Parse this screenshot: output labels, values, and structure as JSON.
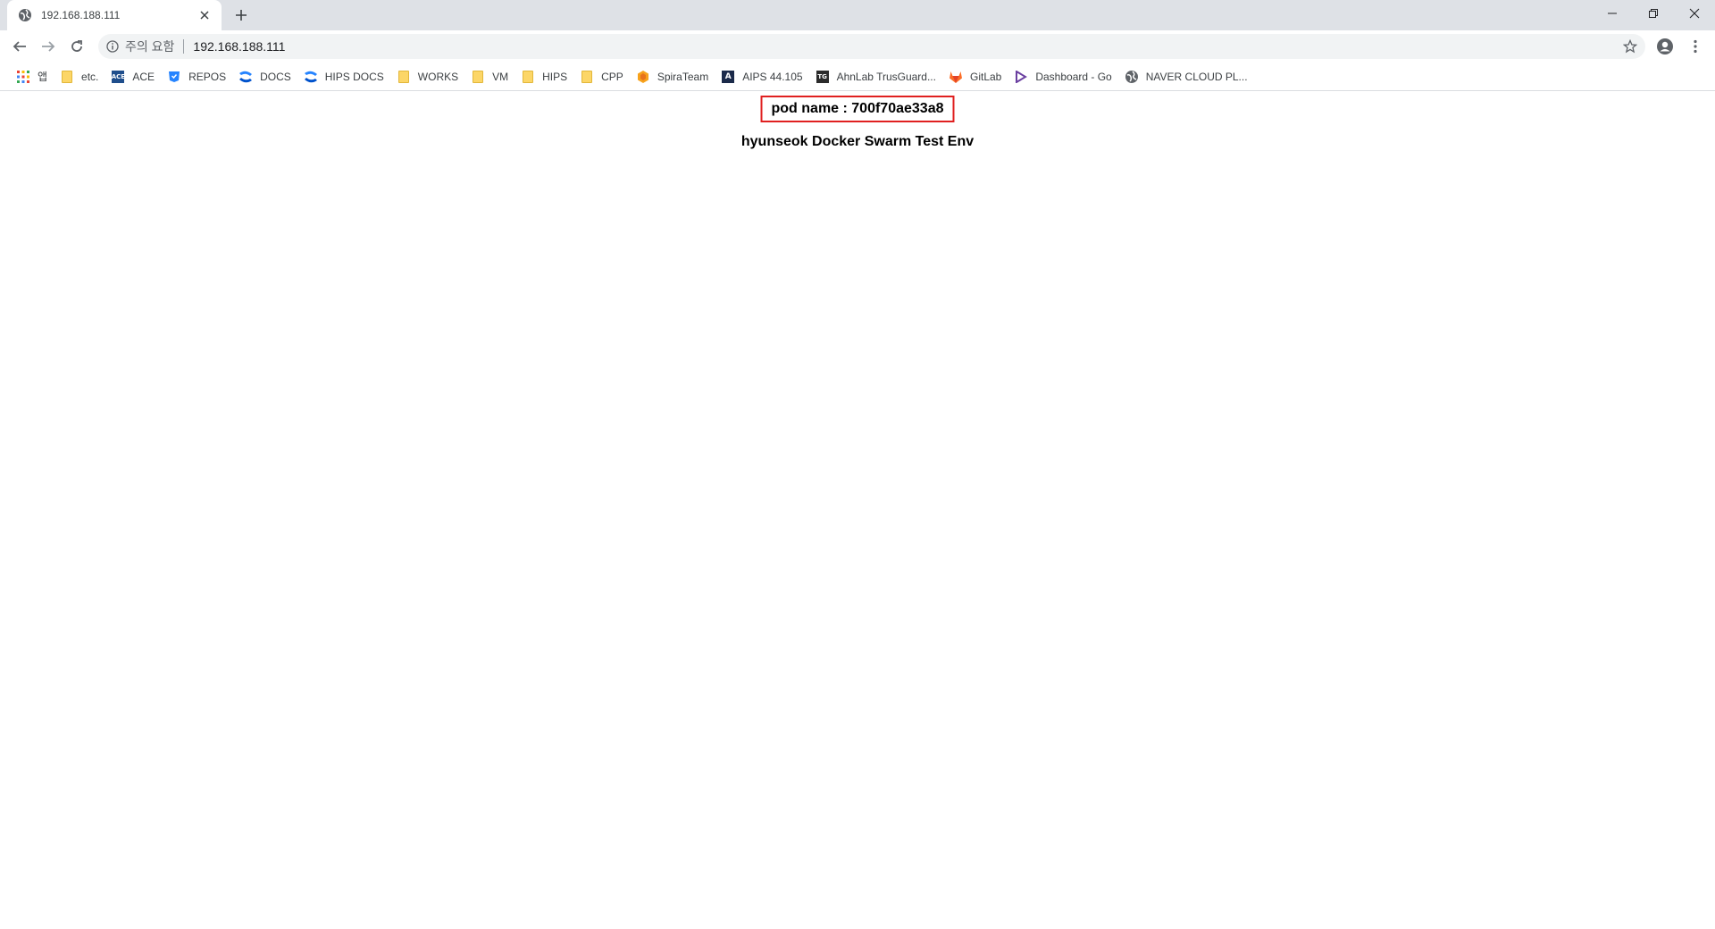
{
  "browser": {
    "tab": {
      "title": "192.168.188.111"
    },
    "address_bar": {
      "security_label": "주의 요함",
      "url": "192.168.188.111"
    }
  },
  "bookmarks": [
    {
      "label": "앱",
      "icon": "apps-grid-icon"
    },
    {
      "label": "etc.",
      "icon": "folder-icon"
    },
    {
      "label": "ACE",
      "icon": "ace-icon"
    },
    {
      "label": "REPOS",
      "icon": "repos-icon"
    },
    {
      "label": "DOCS",
      "icon": "confluence-icon"
    },
    {
      "label": "HIPS DOCS",
      "icon": "confluence-icon"
    },
    {
      "label": "WORKS",
      "icon": "folder-icon"
    },
    {
      "label": "VM",
      "icon": "folder-icon"
    },
    {
      "label": "HIPS",
      "icon": "folder-icon"
    },
    {
      "label": "CPP",
      "icon": "folder-icon"
    },
    {
      "label": "SpiraTeam",
      "icon": "spirateam-icon"
    },
    {
      "label": "AIPS 44.105",
      "icon": "aips-icon"
    },
    {
      "label": "AhnLab TrusGuard...",
      "icon": "trusguard-icon"
    },
    {
      "label": "GitLab",
      "icon": "gitlab-icon"
    },
    {
      "label": "Dashboard - Go",
      "icon": "dashboard-icon"
    },
    {
      "label": "NAVER CLOUD PL...",
      "icon": "globe-icon"
    }
  ],
  "page": {
    "pod_name": "pod name : 700f70ae33a8",
    "heading": "hyunseok Docker Swarm Test Env"
  },
  "colors": {
    "pod_border": "#e02020",
    "tabstrip_bg": "#dee1e6",
    "omnibox_bg": "#f1f3f4"
  }
}
